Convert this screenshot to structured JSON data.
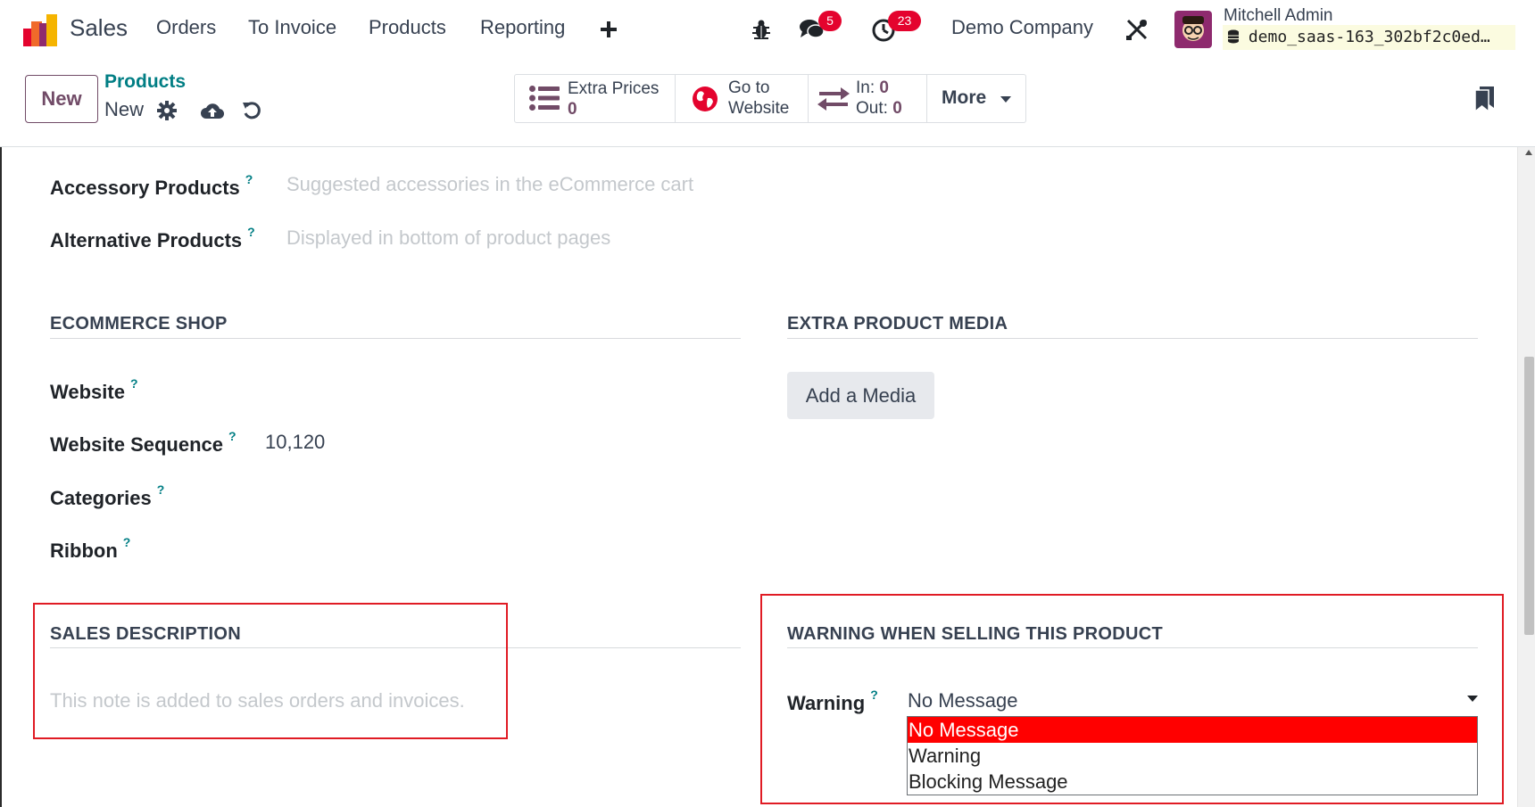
{
  "navbar": {
    "app_name": "Sales",
    "menu": [
      "Orders",
      "To Invoice",
      "Products",
      "Reporting"
    ],
    "messages_count": "5",
    "activities_count": "23",
    "company": "Demo Company",
    "user_name": "Mitchell Admin",
    "database": "demo_saas-163_302bf2c0ed…"
  },
  "control": {
    "new_label": "New",
    "breadcrumb_parent": "Products",
    "breadcrumb_current": "New",
    "stats": {
      "extra_prices_label": "Extra Prices",
      "extra_prices_value": "0",
      "goto_line1": "Go to",
      "goto_line2": "Website",
      "in_label": "In:",
      "in_value": "0",
      "out_label": "Out:",
      "out_value": "0",
      "more_label": "More"
    }
  },
  "form": {
    "accessory_label": "Accessory Products",
    "accessory_placeholder": "Suggested accessories in the eCommerce cart",
    "alternative_label": "Alternative Products",
    "alternative_placeholder": "Displayed in bottom of product pages",
    "ecommerce_title": "ECOMMERCE SHOP",
    "website_label": "Website",
    "website_sequence_label": "Website Sequence",
    "website_sequence_value": "10,120",
    "categories_label": "Categories",
    "ribbon_label": "Ribbon",
    "media_title": "EXTRA PRODUCT MEDIA",
    "add_media_label": "Add a Media",
    "sales_desc_title": "SALES DESCRIPTION",
    "sales_desc_placeholder": "This note is added to sales orders and invoices.",
    "warning_title": "WARNING WHEN SELLING THIS PRODUCT",
    "warning_label": "Warning",
    "warning_value": "No Message",
    "warning_options": [
      "No Message",
      "Warning",
      "Blocking Message"
    ],
    "help_mark": "?"
  },
  "colors": {
    "brand": "#714b67",
    "link": "#017e84",
    "badge": "#e4032e",
    "highlight": "#e01b24",
    "selected_option": "#ff0000"
  }
}
